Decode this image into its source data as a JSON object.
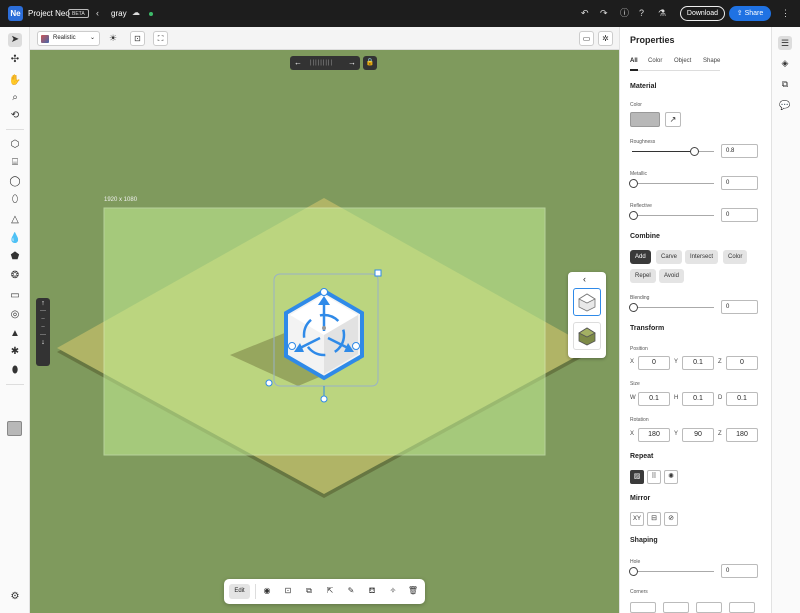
{
  "topbar": {
    "logo": "Ne",
    "app_name": "Project Neo",
    "beta": "BETA",
    "doc_name": "gray",
    "download": "Download",
    "share": "Share"
  },
  "canvas": {
    "render_mode": "Realistic",
    "artboard_size": "1920 x 1080",
    "bottom_bar": {
      "edit": "Edit"
    }
  },
  "properties": {
    "title": "Properties",
    "tabs": [
      "All",
      "Color",
      "Object",
      "Shape"
    ],
    "active_tab": "All",
    "material": {
      "heading": "Material",
      "color_label": "Color",
      "color_value": "#b8b8b8",
      "roughness_label": "Roughness",
      "roughness": "0.8",
      "metallic_label": "Metallic",
      "metallic": "0",
      "reflective_label": "Reflective",
      "reflective": "0"
    },
    "combine": {
      "heading": "Combine",
      "ops": [
        "Add",
        "Carve",
        "Intersect",
        "Color",
        "Repel",
        "Avoid"
      ],
      "active": "Add",
      "blending_label": "Blending",
      "blending": "0"
    },
    "transform": {
      "heading": "Transform",
      "position_label": "Position",
      "position": {
        "x": "0",
        "y": "0.1",
        "z": "0"
      },
      "size_label": "Size",
      "size": {
        "w": "0.1",
        "h": "0.1",
        "d": "0.1"
      },
      "rotation_label": "Rotation",
      "rotation": {
        "x": "180",
        "y": "90",
        "z": "180"
      }
    },
    "repeat": {
      "heading": "Repeat"
    },
    "mirror": {
      "heading": "Mirror",
      "xy_label": "XY"
    },
    "shaping": {
      "heading": "Shaping",
      "hole_label": "Hole",
      "hole": "0",
      "corners_label": "Corners"
    }
  },
  "axis_letters": {
    "x": "X",
    "y": "Y",
    "z": "Z",
    "w": "W",
    "h": "H",
    "d": "D"
  },
  "colors": {
    "accent": "#1f72e3",
    "ground": "#7f9a5d",
    "artboard": "#c5f095",
    "selection": "#2f8ae8"
  }
}
